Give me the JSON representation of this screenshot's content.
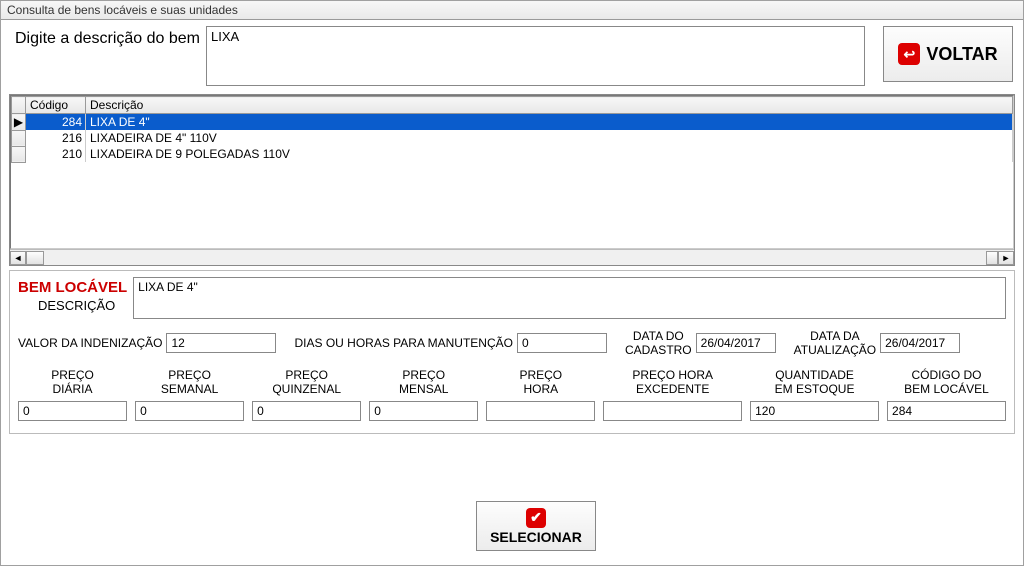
{
  "titlebar": "Consulta de bens locáveis e suas unidades",
  "top": {
    "label": "Digite a descrição do bem",
    "search_value": "LIXA",
    "voltar_label": "VOLTAR"
  },
  "grid": {
    "headers": {
      "codigo": "Código",
      "descricao": "Descrição"
    },
    "rows": [
      {
        "codigo": "284",
        "descricao": "LIXA DE 4\"",
        "selected": true,
        "marker": "▶"
      },
      {
        "codigo": "216",
        "descricao": "LIXADEIRA DE 4\" 110V",
        "selected": false,
        "marker": ""
      },
      {
        "codigo": "210",
        "descricao": "LIXADEIRA DE 9 POLEGADAS 110V",
        "selected": false,
        "marker": ""
      }
    ]
  },
  "detail": {
    "bem_label": "BEM LOCÁVEL",
    "desc_label": "DESCRIÇÃO",
    "desc_value": "LIXA DE 4\"",
    "inden_label": "VALOR DA INDENIZAÇÃO",
    "inden_value": "12",
    "manut_label": "DIAS OU HORAS PARA MANUTENÇÃO",
    "manut_value": "0",
    "cad_label": "DATA DO\nCADASTRO",
    "cad_value": "26/04/2017",
    "atu_label": "DATA DA\nATUALIZAÇÃO",
    "atu_value": "26/04/2017",
    "cols": [
      {
        "label": "PREÇO\nDIÁRIA",
        "value": "0",
        "name": "preco-diaria"
      },
      {
        "label": "PREÇO\nSEMANAL",
        "value": "0",
        "name": "preco-semanal"
      },
      {
        "label": "PREÇO\nQUINZENAL",
        "value": "0",
        "name": "preco-quinzenal"
      },
      {
        "label": "PREÇO\nMENSAL",
        "value": "0",
        "name": "preco-mensal"
      },
      {
        "label": "PREÇO\nHORA",
        "value": "",
        "name": "preco-hora"
      },
      {
        "label": "PREÇO HORA\nEXCEDENTE",
        "value": "",
        "name": "preco-hora-excedente"
      },
      {
        "label": "QUANTIDADE\nEM ESTOQUE",
        "value": "120",
        "name": "quantidade-estoque"
      },
      {
        "label": "CÓDIGO DO\nBEM LOCÁVEL",
        "value": "284",
        "name": "codigo-bem-locavel"
      }
    ]
  },
  "selecionar_label": "SELECIONAR"
}
